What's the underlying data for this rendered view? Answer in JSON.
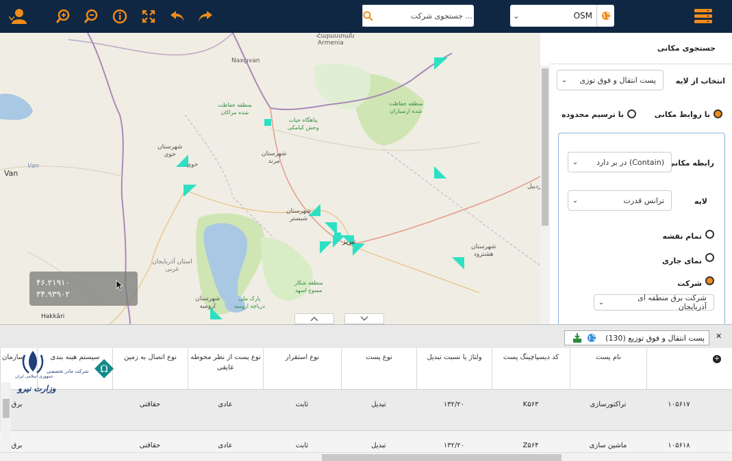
{
  "toolbar": {
    "search_placeholder": "جستجوی شرکت ...",
    "basemap_value": "OSM",
    "icons": [
      "user-icon",
      "zoom-in-icon",
      "zoom-out-icon",
      "info-icon",
      "fullscreen-icon",
      "undo-icon",
      "redo-icon",
      "menu-icon",
      "search-icon",
      "globe-icon"
    ],
    "accent_color": "#f28c1a",
    "bar_color": "#0f2742"
  },
  "map": {
    "labels": {
      "armenia": "Հայաստան",
      "armenia2": "Armenia",
      "nakhchivan": "Naxçıvan",
      "van_lake": "Van",
      "van_city": "Van",
      "hakkari": "Hakkâri",
      "khoy": "خوی",
      "tabriz": "تبریز",
      "ardabil": "اردبیل",
      "city_khoy": "شهرستان\nخوی",
      "city_marand": "شهرستان\nمرند",
      "city_shabestar": "شهرستان\nشبستر",
      "city_urmia": "شهرستان\nارومیه",
      "city_hashtrud": "شهرستان\nهشترود",
      "prov_west": "استان آذربایجان\nغربی",
      "park_urmia": "پارک ملی\nدریاچه ارومیه",
      "protected_marakan": "منطقه حفاظت\nشده مراکان",
      "refuge_kiamaki": "پناهگاه حیات\nوحش کیامکی",
      "protected_arasbaran": "منطقه حفاظت\nشده ارسباران",
      "hunting_zone": "منطقه شکار\nممنوع اسهد"
    },
    "coords": {
      "line1": "۴۶.۲۱۹۱۰",
      "line2": "۳۴.۹۳۹۰۲"
    }
  },
  "panel": {
    "title": "جستجوی مکانی",
    "layer_select_label": "انتخاب از لایه",
    "layer_select_value": "پست انتقال و فوق توزی",
    "mode_spatial": "با روابط مکانی",
    "mode_draw": "با ترسیم محدوده",
    "relation_label": "رابطه مکانی",
    "relation_value": "در بر دارد (Contain)",
    "layer_label": "لایه",
    "layer_value": "ترانس قدرت",
    "opt_full_map": "تمام نقشه",
    "opt_current_view": "نمای جاری",
    "opt_company": "شرکت",
    "company_value": "شرکت برق منطقه ای آذربایجان"
  },
  "grid": {
    "title": "پست انتقال و فوق توزیع (130)",
    "columns": [
      "نام پست",
      "کد دیسپاچینگ پست",
      "ولتاژ یا نسبت تبدیل",
      "نوع پست",
      "نوع استقرار",
      "نوع پست از نظر محوطه عایقی",
      "نوع اتصال به زمین",
      "سیستم هینه بندی",
      "سازمان"
    ],
    "rows": [
      {
        "id": "۱۰۵۶۱۷",
        "name": "تراکتورسازی",
        "code": "K۵۶۳",
        "voltage": "۱۳۲/۲۰",
        "type": "تبدیل",
        "install": "ثابت",
        "insulation": "عادی",
        "ground": "حقاقتی",
        "org": "برق منـ"
      },
      {
        "id": "۱۰۵۶۱۸",
        "name": "ماشین سازی",
        "code": "Z۵۶۴",
        "voltage": "۱۳۲/۲۰",
        "type": "تبدیل",
        "install": "ثابت",
        "insulation": "عادی",
        "ground": "حقاقتی",
        "org": "برق منـ"
      }
    ]
  },
  "logo": {
    "emblem": "جمهوری اسلامی ایران",
    "org_line": "وزارت نیرو",
    "sub_line": "شرکت مادر تخصصی"
  }
}
